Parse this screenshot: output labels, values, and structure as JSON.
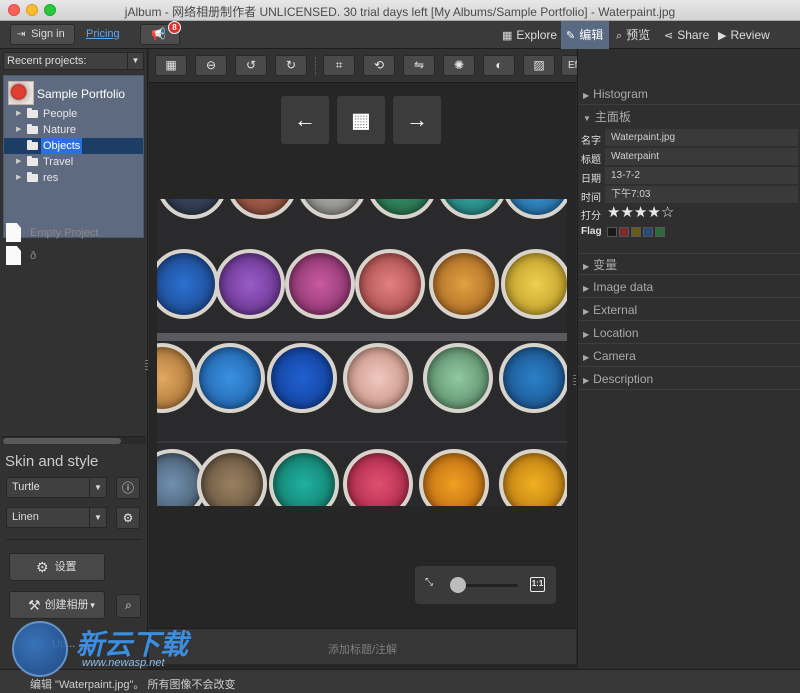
{
  "window": {
    "title": "jAlbum - 网络相册制作者 UNLICENSED. 30 trial days left [My Albums/Sample Portfolio] - Waterpaint.jpg"
  },
  "toolbar": {
    "signin": "Sign in",
    "pricing": "Pricing",
    "notif_badge": "8",
    "nav": [
      {
        "label": "Explore",
        "icon": "grid-icon"
      },
      {
        "label": "编辑",
        "icon": "pencil-icon"
      },
      {
        "label": "预览",
        "icon": "magnifier-icon"
      },
      {
        "label": "Share",
        "icon": "share-icon"
      },
      {
        "label": "Review",
        "icon": "play-icon"
      }
    ]
  },
  "sidebar": {
    "recent_label": "Recent projects:",
    "project_title": "Sample Portfolio",
    "tree": [
      {
        "label": "People",
        "selected": false
      },
      {
        "label": "Nature",
        "selected": false
      },
      {
        "label": "Objects",
        "selected": true
      },
      {
        "label": "Travel",
        "selected": false
      },
      {
        "label": "res",
        "selected": false
      }
    ],
    "other_projects": [
      "ð",
      "Empty Project"
    ],
    "skin_heading": "Skin and style",
    "skin_value": "Turtle",
    "style_value": "Linen",
    "settings_label": "设置",
    "make_album_label": "创建相册",
    "upgrade_label": "Up..."
  },
  "editor": {
    "effects_label": "Effects",
    "caption_placeholder": "添加标题/注解",
    "zoom_level": 0.1
  },
  "panel": {
    "sections_top": [
      "Histogram",
      "主面板"
    ],
    "props": [
      {
        "key": "名字",
        "value": "Waterpaint.jpg"
      },
      {
        "key": "标题",
        "value": "Waterpaint"
      },
      {
        "key": "日期",
        "value": "13-7-2"
      },
      {
        "key": "时间",
        "value": "下午7:03"
      }
    ],
    "rating_label": "打分",
    "rating": 4,
    "rating_max": 5,
    "flag_label": "Flag",
    "flag_colors": [
      "#1a1a1a",
      "#7a2a2a",
      "#6a5a1a",
      "#2a4a7a",
      "#2a6a3a"
    ],
    "sections_bottom": [
      "变量",
      "Image data",
      "External",
      "Location",
      "Camera",
      "Description"
    ]
  },
  "status": {
    "text": "编辑 \"Waterpaint.jpg\"。 所有图像不会改变"
  },
  "watermark": {
    "name": "新云下载",
    "url": "www.newasp.net"
  },
  "colors": {
    "selection": "#2d6fe0",
    "project_bg": "#5d6a80",
    "active_nav": "#5a6a82",
    "link": "#5da7f5"
  }
}
